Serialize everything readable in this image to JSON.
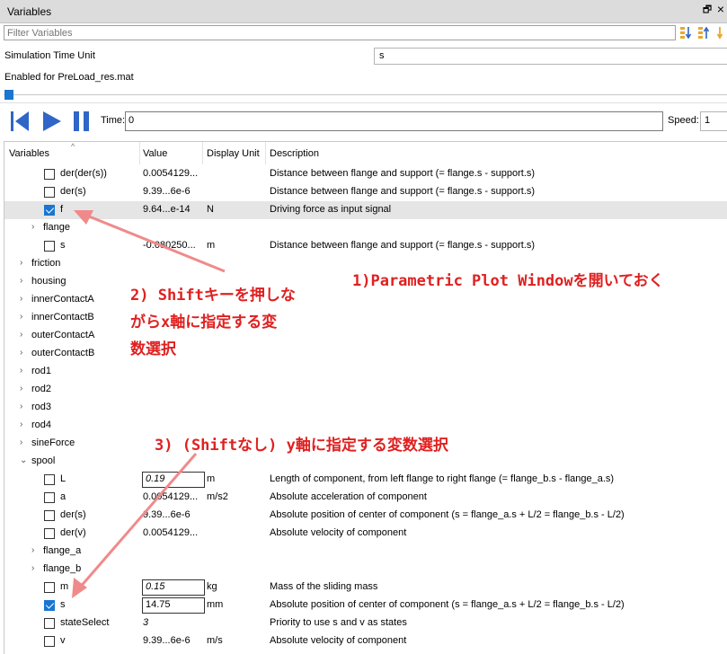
{
  "window": {
    "title": "Variables",
    "restore_glyph": "🗗",
    "close_glyph": "×"
  },
  "filter": {
    "placeholder": "Filter Variables",
    "value": ""
  },
  "sim": {
    "label": "Simulation Time Unit",
    "unit": "s",
    "enabled_text": "Enabled for PreLoad_res.mat"
  },
  "slider": {
    "position": 0
  },
  "playback": {
    "time_label": "Time:",
    "time_value": "0",
    "speed_label": "Speed:",
    "speed_value": "1"
  },
  "columns": [
    "Variables",
    "Value",
    "Display Unit",
    "Description"
  ],
  "rows": [
    {
      "name": "der(der(s))",
      "indent": 2,
      "checkbox": true,
      "checked": false,
      "value": "0.0054129...",
      "unit": "",
      "desc": "Distance between flange and support (= flange.s - support.s)"
    },
    {
      "name": "der(s)",
      "indent": 2,
      "checkbox": true,
      "checked": false,
      "value": "9.39...6e-6",
      "unit": "",
      "desc": "Distance between flange and support (= flange.s - support.s)"
    },
    {
      "name": "f",
      "indent": 2,
      "checkbox": true,
      "checked": true,
      "selected": true,
      "value": "9.64...e-14",
      "unit": "N",
      "desc": "Driving force as input signal"
    },
    {
      "name": "flange",
      "indent": 1,
      "expander": "›",
      "value": "",
      "unit": "",
      "desc": ""
    },
    {
      "name": "s",
      "indent": 2,
      "checkbox": true,
      "checked": false,
      "value": "-0.080250...",
      "unit": "m",
      "desc": "Distance between flange and support (= flange.s - support.s)"
    },
    {
      "name": "friction",
      "indent": 0,
      "expander": "›",
      "value": "",
      "unit": "",
      "desc": ""
    },
    {
      "name": "housing",
      "indent": 0,
      "expander": "›",
      "value": "",
      "unit": "",
      "desc": ""
    },
    {
      "name": "innerContactA",
      "indent": 0,
      "expander": "›",
      "value": "",
      "unit": "",
      "desc": ""
    },
    {
      "name": "innerContactB",
      "indent": 0,
      "expander": "›",
      "value": "",
      "unit": "",
      "desc": ""
    },
    {
      "name": "outerContactA",
      "indent": 0,
      "expander": "›",
      "value": "",
      "unit": "",
      "desc": ""
    },
    {
      "name": "outerContactB",
      "indent": 0,
      "expander": "›",
      "value": "",
      "unit": "",
      "desc": ""
    },
    {
      "name": "rod1",
      "indent": 0,
      "expander": "›",
      "value": "",
      "unit": "",
      "desc": ""
    },
    {
      "name": "rod2",
      "indent": 0,
      "expander": "›",
      "value": "",
      "unit": "",
      "desc": ""
    },
    {
      "name": "rod3",
      "indent": 0,
      "expander": "›",
      "value": "",
      "unit": "",
      "desc": ""
    },
    {
      "name": "rod4",
      "indent": 0,
      "expander": "›",
      "value": "",
      "unit": "",
      "desc": ""
    },
    {
      "name": "sineForce",
      "indent": 0,
      "expander": "›",
      "value": "",
      "unit": "",
      "desc": ""
    },
    {
      "name": "spool",
      "indent": 0,
      "expander": "⌄",
      "value": "",
      "unit": "",
      "desc": ""
    },
    {
      "name": "L",
      "indent": 2,
      "checkbox": true,
      "checked": false,
      "value": "0.19",
      "editable": true,
      "italic": true,
      "unit": "m",
      "desc": "Length of component, from left flange to right flange (= flange_b.s - flange_a.s)"
    },
    {
      "name": "a",
      "indent": 2,
      "checkbox": true,
      "checked": false,
      "value": "0.0054129...",
      "unit": "m/s2",
      "desc": "Absolute acceleration of component"
    },
    {
      "name": "der(s)",
      "indent": 2,
      "checkbox": true,
      "checked": false,
      "value": "9.39...6e-6",
      "unit": "",
      "desc": "Absolute position of center of component (s = flange_a.s + L/2 = flange_b.s - L/2)"
    },
    {
      "name": "der(v)",
      "indent": 2,
      "checkbox": true,
      "checked": false,
      "value": "0.0054129...",
      "unit": "",
      "desc": "Absolute velocity of component"
    },
    {
      "name": "flange_a",
      "indent": 1,
      "expander": "›",
      "value": "",
      "unit": "",
      "desc": ""
    },
    {
      "name": "flange_b",
      "indent": 1,
      "expander": "›",
      "value": "",
      "unit": "",
      "desc": ""
    },
    {
      "name": "m",
      "indent": 2,
      "checkbox": true,
      "checked": false,
      "value": "0.15",
      "editable": true,
      "italic": true,
      "unit": "kg",
      "desc": "Mass of the sliding mass"
    },
    {
      "name": "s",
      "indent": 2,
      "checkbox": true,
      "checked": true,
      "value": "14.75",
      "editable": true,
      "unit": "mm",
      "desc": "Absolute position of center of component (s = flange_a.s + L/2 = flange_b.s - L/2)"
    },
    {
      "name": "stateSelect",
      "indent": 2,
      "checkbox": true,
      "checked": false,
      "value": "3",
      "italic": true,
      "unit": "",
      "desc": "Priority to use s and v as states"
    },
    {
      "name": "v",
      "indent": 2,
      "checkbox": true,
      "checked": false,
      "value": "9.39...6e-6",
      "unit": "m/s",
      "desc": "Absolute velocity of component"
    }
  ],
  "annotations": {
    "step1": "1)Parametric Plot Windowを開いておく",
    "step2_line1": "2) Shiftキーを押しな",
    "step2_line2": "がらx軸に指定する変",
    "step2_line3": "数選択",
    "step3": "3) (Shiftなし) y軸に指定する変数選択"
  },
  "colors": {
    "accent": "#1976d2",
    "annotation": "#e02020",
    "arrow": "#f08a8a",
    "selected_row": "#e5e5e5"
  }
}
